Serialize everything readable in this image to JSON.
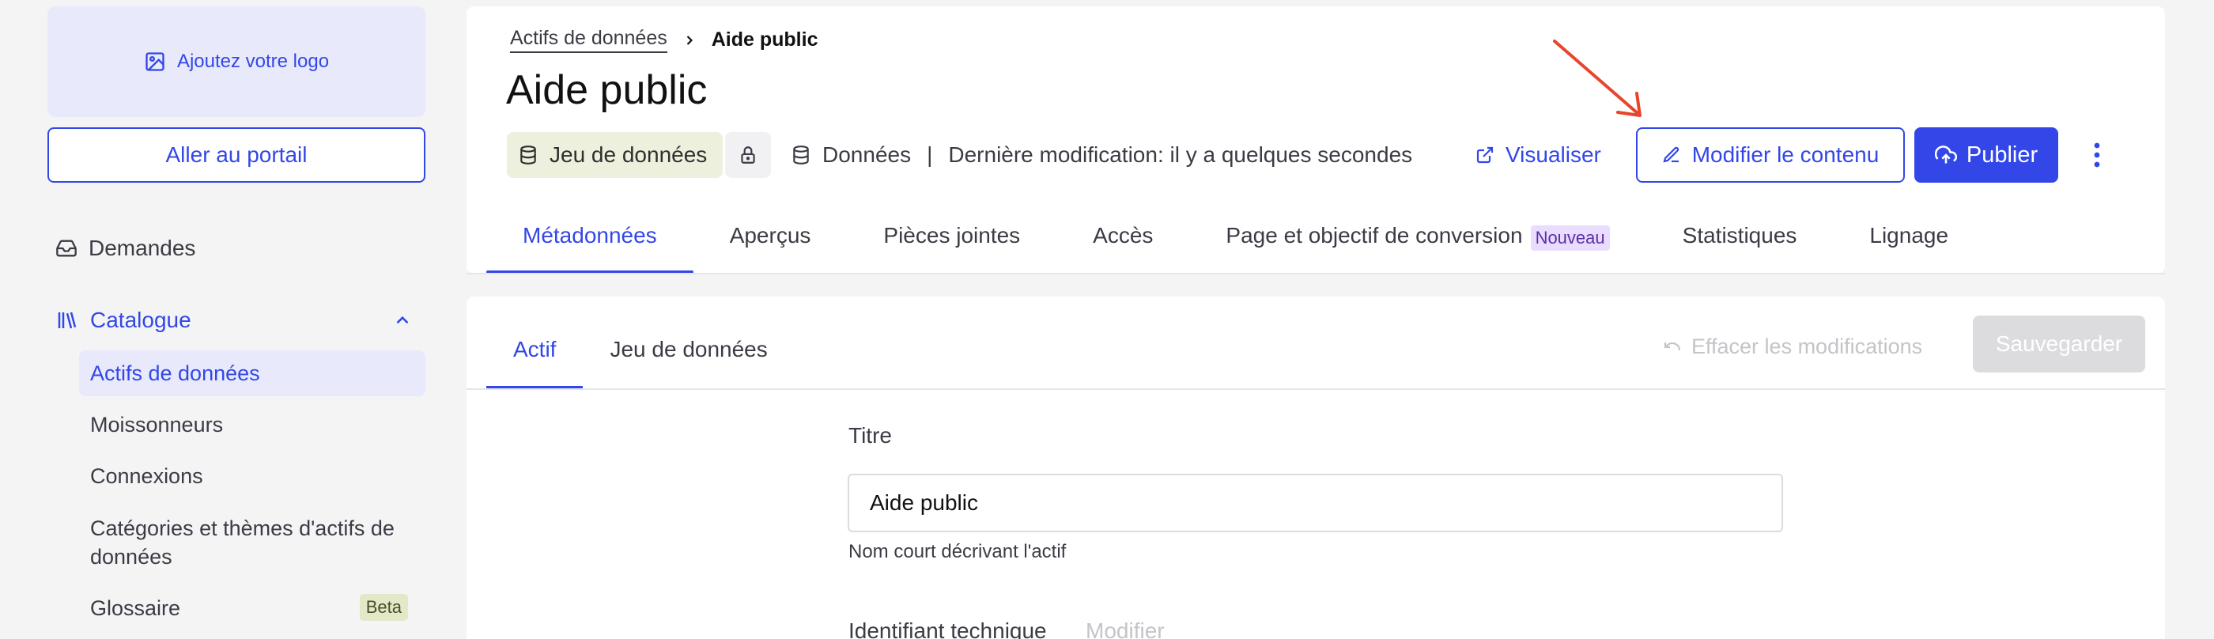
{
  "sidebar": {
    "logo_label": "Ajoutez votre logo",
    "portal_button": "Aller au portail",
    "demandes": "Demandes",
    "catalogue": "Catalogue",
    "sub_items": [
      "Actifs de données",
      "Moissonneurs",
      "Connexions",
      "Catégories et thèmes d'actifs de données",
      "Glossaire"
    ],
    "beta_badge": "Beta"
  },
  "header": {
    "breadcrumb": {
      "parent": "Actifs de données",
      "current": "Aide public"
    },
    "title": "Aide public",
    "type_badge": "Jeu de données",
    "meta_source": "Données",
    "meta_separator": "|",
    "meta_modified": "Dernière modification: il y a quelques secondes",
    "visualiser": "Visualiser",
    "modifier": "Modifier le contenu",
    "publier": "Publier"
  },
  "tabs": [
    {
      "label": "Métadonnées",
      "active": true
    },
    {
      "label": "Aperçus"
    },
    {
      "label": "Pièces jointes"
    },
    {
      "label": "Accès"
    },
    {
      "label": "Page et objectif de conversion",
      "badge": "Nouveau"
    },
    {
      "label": "Statistiques"
    },
    {
      "label": "Lignage"
    }
  ],
  "content": {
    "subtabs": [
      "Actif",
      "Jeu de données"
    ],
    "effacer": "Effacer les modifications",
    "sauvegarder": "Sauvegarder",
    "title_label": "Titre",
    "title_value": "Aide public",
    "title_help": "Nom court décrivant l'actif",
    "tech_id_label": "Identifiant technique",
    "tech_id_modify": "Modifier"
  },
  "colors": {
    "accent": "#3347e8",
    "annotation_arrow": "#e8452c",
    "badge_bg": "#eef0de",
    "new_badge_bg": "#eadcff"
  }
}
